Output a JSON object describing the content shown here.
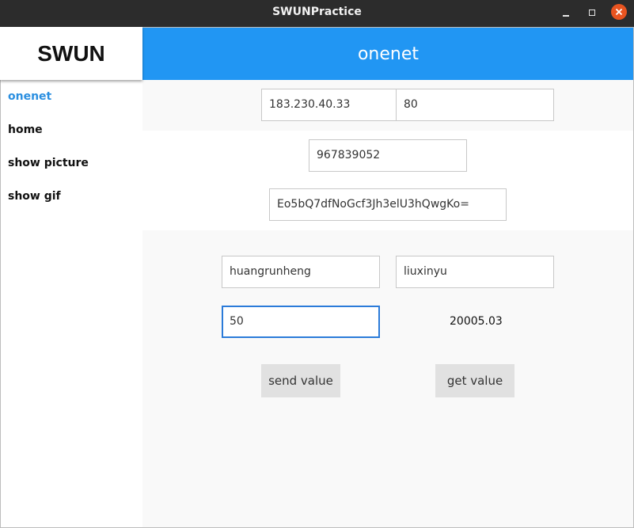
{
  "window": {
    "title": "SWUNPractice",
    "close_color": "#e95420"
  },
  "sidebar": {
    "logo": "SWUN",
    "items": [
      {
        "label": "onenet",
        "active": true
      },
      {
        "label": "home",
        "active": false
      },
      {
        "label": "show picture",
        "active": false
      },
      {
        "label": "show gif",
        "active": false
      }
    ]
  },
  "main": {
    "header": "onenet",
    "accent": "#2196f3",
    "fields": {
      "ip": "183.230.40.33",
      "port": "80",
      "device_id": "967839052",
      "api_key": "Eo5bQ7dfNoGcf3Jh3elU3hQwgKo=",
      "user_a": "huangrunheng",
      "user_b": "liuxinyu",
      "send_input": "50"
    },
    "received_value": "20005.03",
    "buttons": {
      "send": "send value",
      "get": "get value"
    }
  }
}
